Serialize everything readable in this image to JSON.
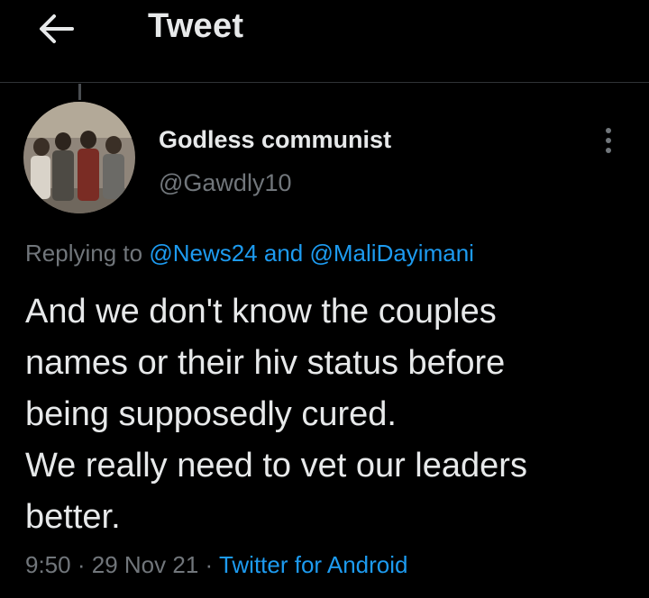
{
  "header": {
    "title": "Tweet",
    "back_icon": "arrow-left-icon"
  },
  "author": {
    "display_name": "Godless communist",
    "handle": "@Gawdly10",
    "avatar_icon": "avatar-image"
  },
  "reply": {
    "prefix": "Replying to",
    "mention_1": "@News24",
    "conjunction": "and",
    "mention_2": "@MaliDayimani"
  },
  "tweet": {
    "lines": [
      "And we don't know the couples",
      "names or their hiv status before",
      "being supposedly cured.",
      "We really need to vet our leaders",
      "better."
    ]
  },
  "meta": {
    "time": "9:50",
    "separator": "·",
    "date": "29 Nov 21",
    "source": "Twitter for Android"
  },
  "colors": {
    "background": "#000000",
    "text": "#e7e9ea",
    "muted": "#71767b",
    "accent": "#1d9bf0"
  }
}
